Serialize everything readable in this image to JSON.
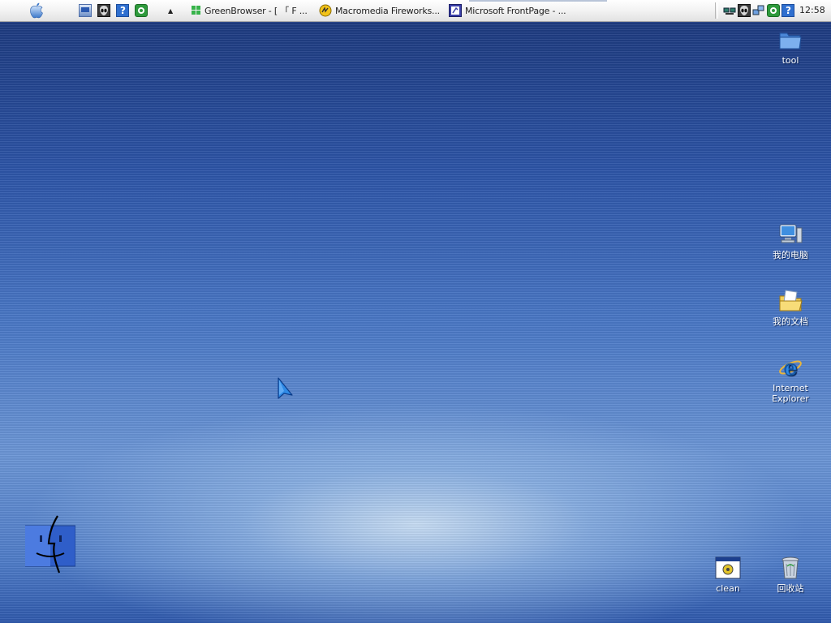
{
  "menubar": {
    "apple_icon": "apple-logo-icon",
    "quicklaunch": [
      "show-desktop-icon",
      "alien-app-icon",
      "help-app-icon",
      "green-refresh-icon"
    ],
    "expand_arrow": "▲",
    "tasks": [
      {
        "label": "GreenBrowser - [ 「 F ...",
        "icon": "greenbrowser-icon"
      },
      {
        "label": "Macromedia Fireworks...",
        "icon": "fireworks-icon"
      },
      {
        "label": "Microsoft FrontPage - ...",
        "icon": "frontpage-icon"
      }
    ],
    "tray_icons": [
      "network-icon",
      "alien-tray-icon",
      "network-computers-icon",
      "green-tray-icon",
      "help-tray-icon"
    ],
    "clock": "12:58"
  },
  "desktop": {
    "icons": {
      "tool": "tool",
      "my_computer": "我的电脑",
      "my_documents": "我的文档",
      "ie_line1": "Internet",
      "ie_line2": "Explorer",
      "clean": "clean",
      "recycle_bin": "回收站"
    }
  },
  "colors": {
    "desktop_top": "#1e3b80",
    "desktop_glow": "#cde1f5",
    "menubar": "#f1f1f1"
  }
}
